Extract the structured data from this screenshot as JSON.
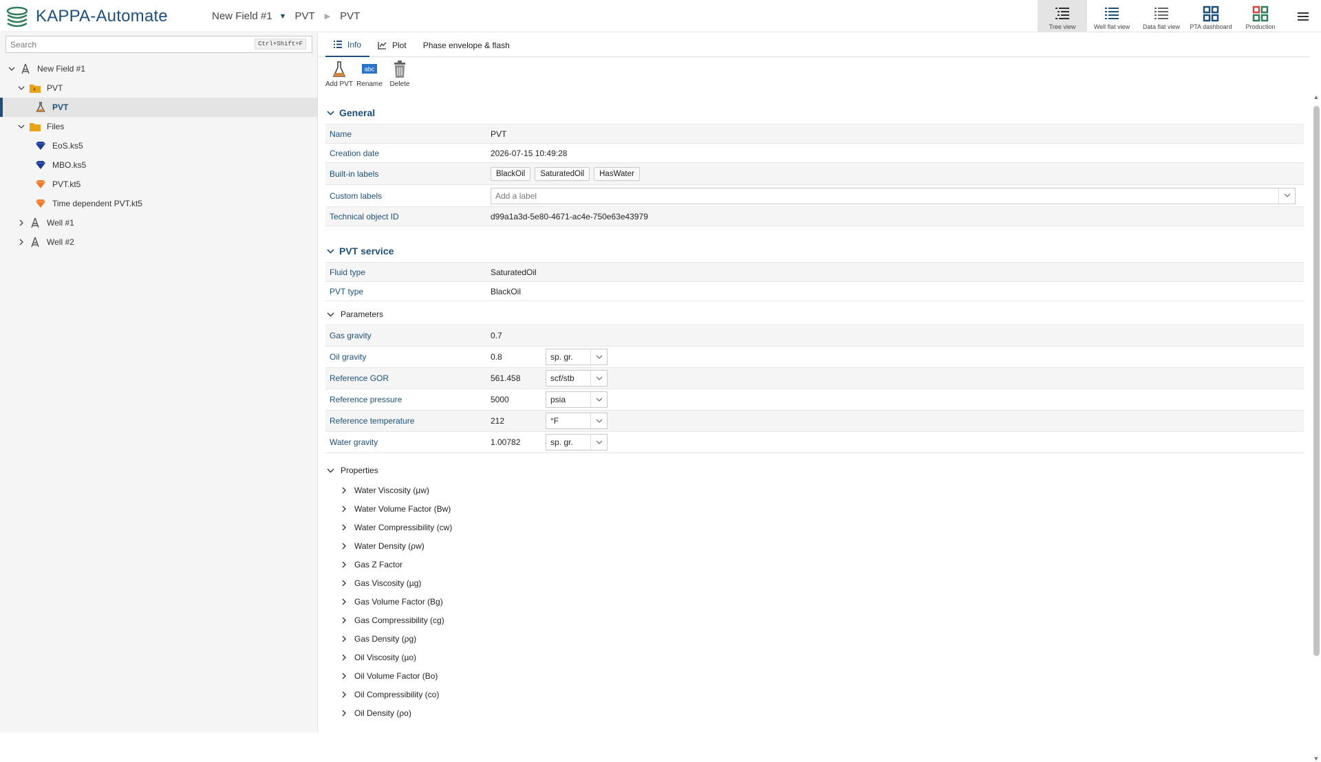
{
  "app": {
    "title": "KAPPA-Automate"
  },
  "breadcrumb": {
    "field": "New Field #1",
    "folder": "PVT",
    "item": "PVT"
  },
  "views": [
    {
      "label": "Tree view",
      "icon": "tree-view-icon"
    },
    {
      "label": "Well flat view",
      "icon": "well-flat-view-icon"
    },
    {
      "label": "Data flat view",
      "icon": "data-flat-view-icon"
    },
    {
      "label": "PTA dashboard",
      "icon": "pta-dashboard-icon"
    },
    {
      "label": "Production",
      "icon": "production-icon"
    }
  ],
  "search": {
    "placeholder": "Search",
    "shortcut": "Ctrl+Shift+F"
  },
  "tree": {
    "field": "New Field #1",
    "pvt_folder": "PVT",
    "pvt_item": "PVT",
    "files_folder": "Files",
    "files": [
      "EoS.ks5",
      "MBO.ks5",
      "PVT.kt5",
      "Time dependent PVT.kt5"
    ],
    "wells": [
      "Well #1",
      "Well #2"
    ]
  },
  "tabs": {
    "info": "Info",
    "plot": "Plot",
    "phase": "Phase envelope & flash"
  },
  "toolbar": {
    "add": "Add PVT",
    "rename": "Rename",
    "delete": "Delete",
    "rename_icon_text": "abc"
  },
  "general": {
    "title": "General",
    "name_label": "Name",
    "name_value": "PVT",
    "creation_label": "Creation date",
    "creation_value": "2026-07-15 10:49:28",
    "builtin_label": "Built-in labels",
    "builtin_tags": [
      "BlackOil",
      "SaturatedOil",
      "HasWater"
    ],
    "custom_label": "Custom labels",
    "custom_placeholder": "Add a label",
    "techid_label": "Technical object ID",
    "techid_value": "d99a1a3d-5e80-4671-ac4e-750e63e43979"
  },
  "pvt_service": {
    "title": "PVT service",
    "fluid_label": "Fluid type",
    "fluid_value": "SaturatedOil",
    "pvt_type_label": "PVT type",
    "pvt_type_value": "BlackOil"
  },
  "parameters": {
    "title": "Parameters",
    "rows": [
      {
        "label": "Gas gravity",
        "value": "0.7",
        "unit": ""
      },
      {
        "label": "Oil gravity",
        "value": "0.8",
        "unit": "sp. gr."
      },
      {
        "label": "Reference GOR",
        "value": "561.458",
        "unit": "scf/stb"
      },
      {
        "label": "Reference pressure",
        "value": "5000",
        "unit": "psia"
      },
      {
        "label": "Reference temperature",
        "value": "212",
        "unit": "°F"
      },
      {
        "label": "Water gravity",
        "value": "1.00782",
        "unit": "sp. gr."
      }
    ]
  },
  "properties": {
    "title": "Properties",
    "items": [
      "Water Viscosity (µw)",
      "Water Volume Factor (Bw)",
      "Water Compressibility (cw)",
      "Water Density (ρw)",
      "Gas Z Factor",
      "Gas Viscosity (µg)",
      "Gas Volume Factor (Bg)",
      "Gas Compressibility (cg)",
      "Gas Density (ρg)",
      "Oil Viscosity (µo)",
      "Oil Volume Factor (Bo)",
      "Oil Compressibility (co)",
      "Oil Density (ρo)"
    ]
  },
  "colors": {
    "accent": "#1d4f7a",
    "folder": "#e8a317",
    "blue_file": "#1f3a93",
    "orange_file": "#f07a2a"
  }
}
